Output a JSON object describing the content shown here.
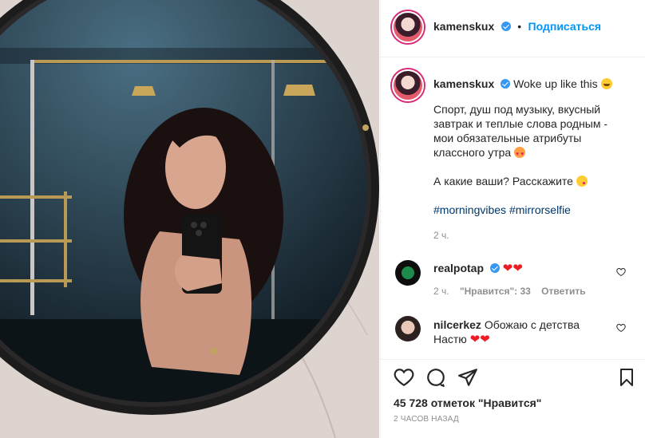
{
  "header": {
    "username": "kamenskux",
    "follow_label": "Подписаться",
    "separator": "•"
  },
  "caption": {
    "username": "kamenskux",
    "first_line": "Woke up like this",
    "lines": [
      "Спорт, душ под музыку, вкусный",
      "завтрак и теплые слова родным -",
      "мои обязательные атрибуты",
      "классного утра"
    ],
    "question": "А какие ваши? Расскажите",
    "hashtags": [
      "#morningvibes",
      "#mirrorselfie"
    ],
    "time": "2 ч."
  },
  "comments": [
    {
      "username": "realpotap",
      "text": "",
      "time": "2 ч.",
      "likes_label": "\"Нравится\": 33",
      "reply_label": "Ответить"
    },
    {
      "username": "nilcerkez",
      "text_line1": "Обожаю с детства",
      "text_line2": "Настю"
    }
  ],
  "actions": {
    "like_icon": "heart-outline-icon",
    "comment_icon": "comment-icon",
    "share_icon": "direct-share-icon",
    "save_icon": "bookmark-icon"
  },
  "stats": {
    "likes_label": "45 728 отметок \"Нравится\"",
    "timestamp": "2 ЧАСОВ НАЗАД"
  },
  "colors": {
    "accent": "#0095f6",
    "verified": "#3897f0",
    "heart": "#ed1c24",
    "hashtag": "#00376b",
    "muted": "#8e8e8e"
  }
}
